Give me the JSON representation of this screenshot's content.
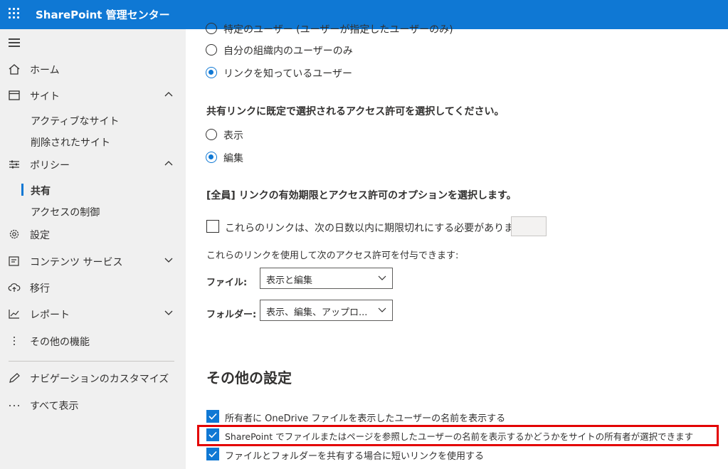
{
  "app": {
    "title": "SharePoint 管理センター"
  },
  "nav": {
    "home": "ホーム",
    "sites": "サイト",
    "active_sites": "アクティブなサイト",
    "deleted_sites": "削除されたサイト",
    "policies": "ポリシー",
    "sharing": "共有",
    "access_control": "アクセスの制御",
    "settings": "設定",
    "content_services": "コンテンツ サービス",
    "migration": "移行",
    "reports": "レポート",
    "more_features": "その他の機能",
    "customize_nav": "ナビゲーションのカスタマイズ",
    "show_all": "すべて表示"
  },
  "link_type": {
    "partial_option": "特定のユーザー (ユーザーが指定したユーザーのみ)",
    "org_only": "自分の組織内のユーザーのみ",
    "anyone": "リンクを知っているユーザー",
    "selected": "anyone"
  },
  "permission": {
    "heading": "共有リンクに既定で選択されるアクセス許可を選択してください。",
    "view": "表示",
    "edit": "編集",
    "selected": "edit"
  },
  "anyone_links": {
    "heading": "[全員] リンクの有効期限とアクセス許可のオプションを選択します。",
    "expire_label": "これらのリンクは、次の日数以内に期限切れにする必要があります",
    "expire_checked": false,
    "expire_days": "",
    "grant_text": "これらのリンクを使用して次のアクセス許可を付与できます:",
    "file_label": "ファイル:",
    "file_value": "表示と編集",
    "folder_label": "フォルダー:",
    "folder_value": "表示、編集、アップロ..."
  },
  "other_settings": {
    "title": "その他の設定",
    "opt1": "所有者に OneDrive ファイルを表示したユーザーの名前を表示する",
    "opt2": "SharePoint でファイルまたはページを参照したユーザーの名前を表示するかどうかをサイトの所有者が選択できます",
    "opt3": "ファイルとフォルダーを共有する場合に短いリンクを使用する",
    "opt1_checked": true,
    "opt2_checked": true,
    "opt3_checked": true
  },
  "colors": {
    "accent": "#0f78d4",
    "highlight": "#e30000",
    "nav_bg": "#f0f0f0"
  }
}
